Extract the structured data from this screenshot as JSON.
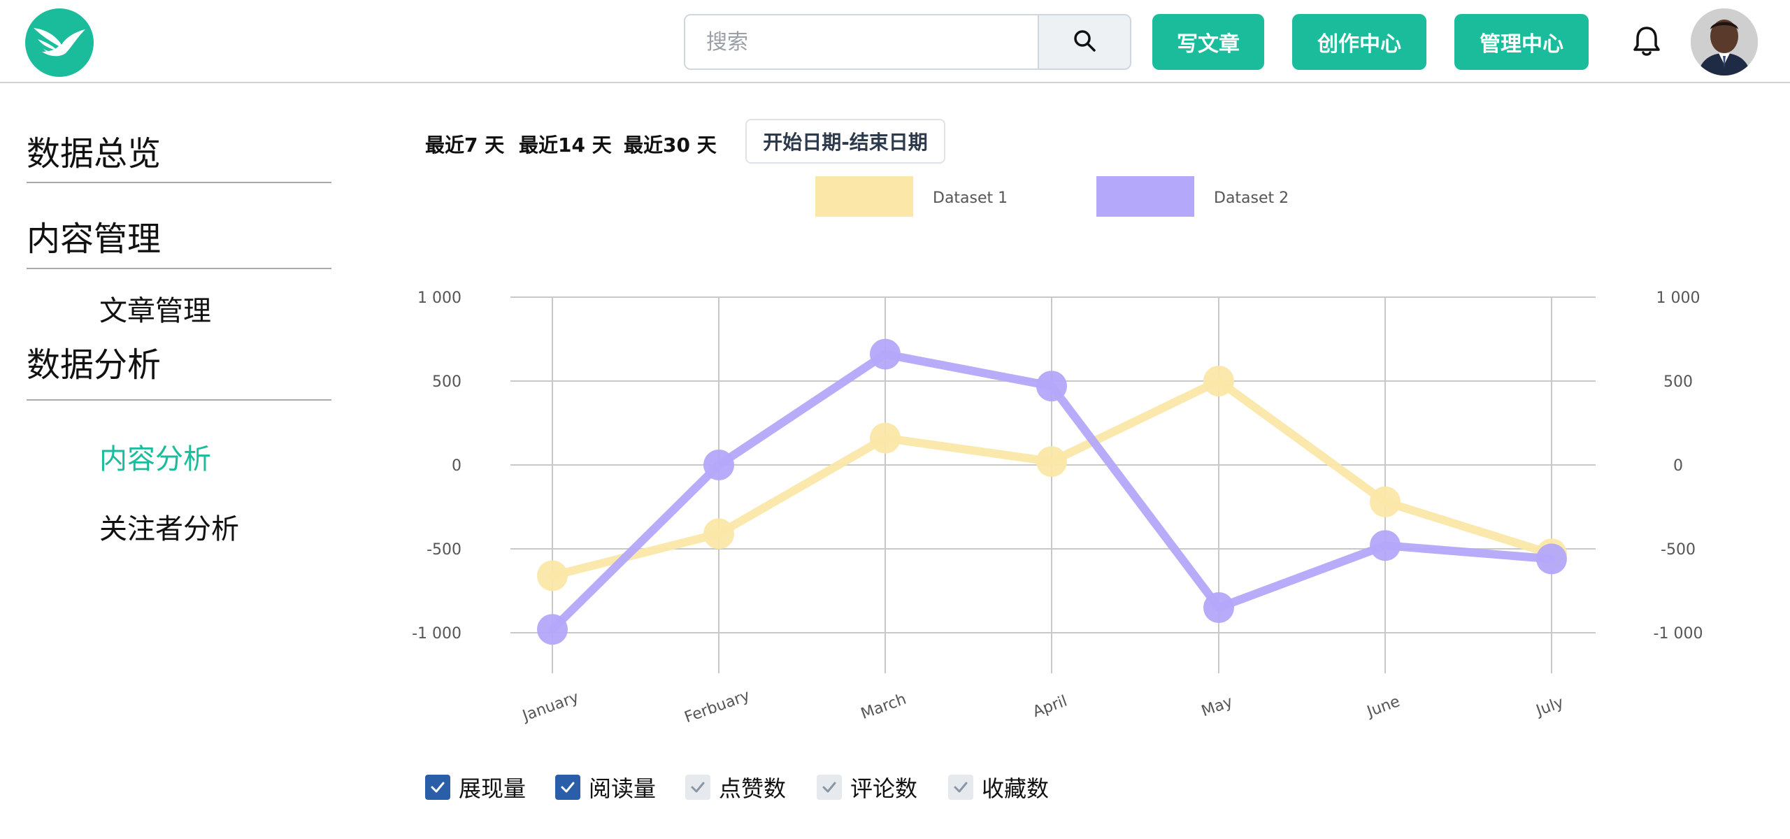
{
  "header": {
    "search_placeholder": "搜索",
    "buttons": {
      "write": "写文章",
      "creator": "创作中心",
      "manage": "管理中心"
    },
    "icons": {
      "logo": "bird-logo",
      "search": "search-icon",
      "bell": "bell-icon",
      "avatar": "user-avatar"
    }
  },
  "sidebar": {
    "sections": [
      "数据总览",
      "内容管理",
      "数据分析"
    ],
    "items": {
      "article_manage": "文章管理",
      "content_analysis": "内容分析",
      "follower_analysis": "关注者分析"
    }
  },
  "filters": {
    "ranges": [
      "最近7 天",
      "最近14 天",
      "最近30 天"
    ],
    "date_range_button": "开始日期-结束日期"
  },
  "chart_data": {
    "type": "line",
    "categories": [
      "January",
      "Ferbuary",
      "March",
      "April",
      "May",
      "June",
      "July"
    ],
    "series": [
      {
        "name": "Dataset 1",
        "color": "#fbe7a8",
        "values": [
          -660,
          -410,
          160,
          20,
          500,
          -220,
          -530
        ]
      },
      {
        "name": "Dataset 2",
        "color": "#b4a8fa",
        "values": [
          -980,
          0,
          660,
          470,
          -850,
          -480,
          -560
        ]
      }
    ],
    "y_ticks": [
      "1 000",
      "500",
      "0",
      "-500",
      "-1 000"
    ],
    "ylim": [
      -1000,
      1000
    ],
    "grid": true,
    "legend_position": "top"
  },
  "metrics": [
    {
      "label": "展现量",
      "checked": true
    },
    {
      "label": "阅读量",
      "checked": true
    },
    {
      "label": "点赞数",
      "checked": false
    },
    {
      "label": "评论数",
      "checked": false
    },
    {
      "label": "收藏数",
      "checked": false
    }
  ]
}
